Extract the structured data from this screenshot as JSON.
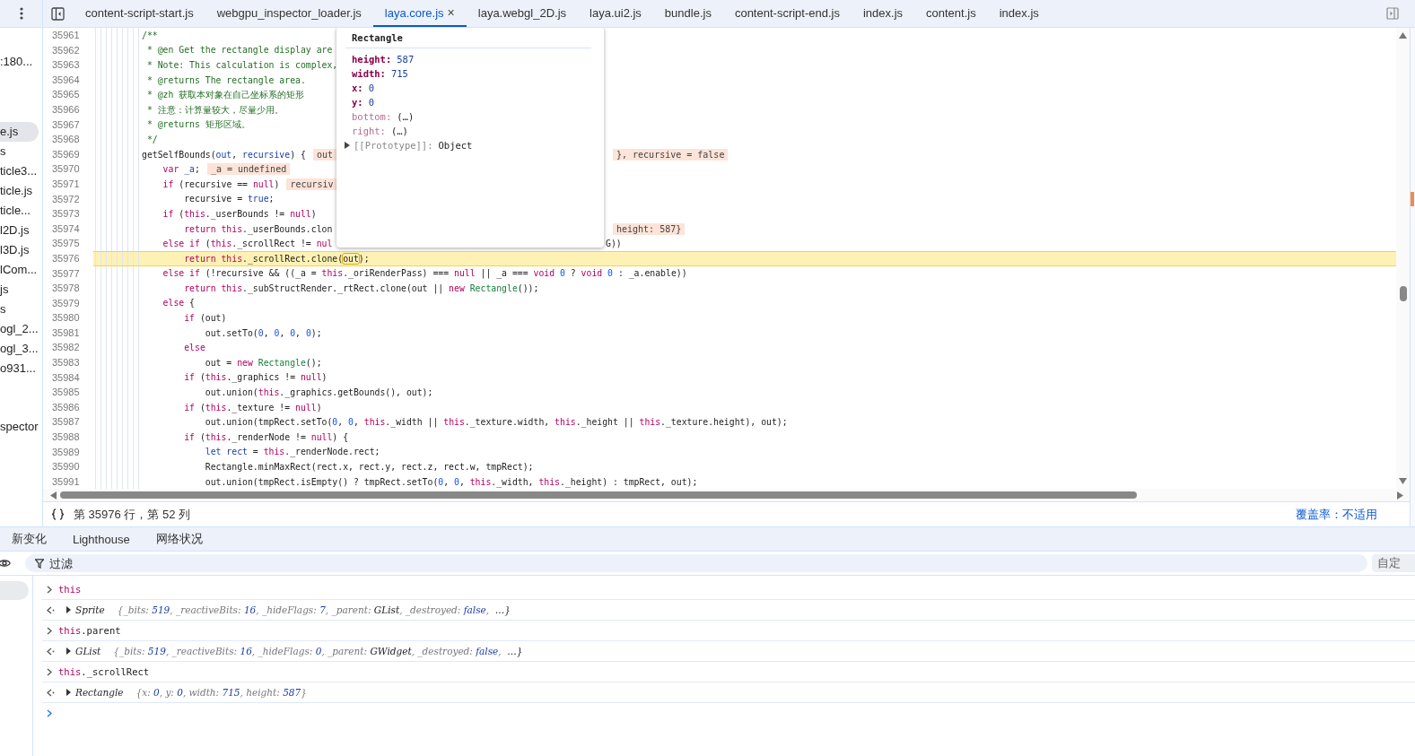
{
  "tabs": [
    {
      "label": "content-script-start.js",
      "selected": false
    },
    {
      "label": "webgpu_inspector_loader.js",
      "selected": false
    },
    {
      "label": "laya.core.js",
      "selected": true,
      "close": "×"
    },
    {
      "label": "laya.webgl_2D.js",
      "selected": false
    },
    {
      "label": "laya.ui2.js",
      "selected": false
    },
    {
      "label": "bundle.js",
      "selected": false
    },
    {
      "label": "content-script-end.js",
      "selected": false
    },
    {
      "label": "index.js",
      "selected": false
    },
    {
      "label": "content.js",
      "selected": false
    },
    {
      "label": "index.js",
      "selected": false
    }
  ],
  "navigator": {
    "groups": [
      [
        {
          "label": ":180...",
          "selected": false
        }
      ],
      [
        {
          "label": "e.js",
          "selected": true
        },
        {
          "label": "s",
          "selected": false
        },
        {
          "label": "ticle3...",
          "selected": false
        },
        {
          "label": "ticle.js",
          "selected": false
        },
        {
          "label": "ticle...",
          "selected": false
        },
        {
          "label": "l2D.js",
          "selected": false
        },
        {
          "label": "l3D.js",
          "selected": false
        },
        {
          "label": "lCom...",
          "selected": false
        },
        {
          "label": "js",
          "selected": false
        },
        {
          "label": "s",
          "selected": false
        },
        {
          "label": "ogl_2...",
          "selected": false
        },
        {
          "label": "ogl_3...",
          "selected": false
        },
        {
          "label": "o931...",
          "selected": false
        }
      ],
      [
        {
          "label": "spector",
          "selected": false
        }
      ]
    ]
  },
  "editor": {
    "lines": [
      {
        "number": "35961",
        "current": false,
        "code": [
          {
            "kind": "comment",
            "text": "/**"
          }
        ]
      },
      {
        "number": "35962",
        "current": false,
        "code": [
          {
            "kind": "comment",
            "text": " * @en Get the rectangle display are"
          }
        ]
      },
      {
        "number": "35963",
        "current": false,
        "code": [
          {
            "kind": "comment",
            "text": " * Note: This calculation is complex,"
          }
        ]
      },
      {
        "number": "35964",
        "current": false,
        "code": [
          {
            "kind": "comment",
            "text": " * @returns The rectangle area."
          }
        ]
      },
      {
        "number": "35965",
        "current": false,
        "code": [
          {
            "kind": "comment",
            "text": " * @zh 获取本对象在自己坐标系的矩形"
          }
        ]
      },
      {
        "number": "35966",
        "current": false,
        "code": [
          {
            "kind": "comment",
            "text": " * 注意：计算量较大，尽量少用。"
          }
        ]
      },
      {
        "number": "35967",
        "current": false,
        "code": [
          {
            "kind": "comment",
            "text": " * @returns 矩形区域。"
          }
        ]
      },
      {
        "number": "35968",
        "current": false,
        "code": [
          {
            "kind": "comment",
            "text": " */"
          }
        ]
      },
      {
        "number": "35969",
        "current": false,
        "code": [
          {
            "kind": "plain",
            "text": "getSelfBounds("
          },
          {
            "kind": "name",
            "text": "out"
          },
          {
            "kind": "plain",
            "text": ", "
          },
          {
            "kind": "name",
            "text": "recursive"
          },
          {
            "kind": "plain",
            "text": ") {"
          }
        ],
        "values": [
          "out"
        ],
        "right_values": [
          "}, recursive = false"
        ]
      },
      {
        "number": "35970",
        "current": false,
        "code": [
          {
            "kind": "keyword",
            "text": "    var "
          },
          {
            "kind": "name",
            "text": "_a"
          },
          {
            "kind": "plain",
            "text": ";"
          }
        ],
        "values": [
          "_a = undefined"
        ]
      },
      {
        "number": "35971",
        "current": false,
        "code": [
          {
            "kind": "keyword",
            "text": "    if "
          },
          {
            "kind": "plain",
            "text": "(recursive == "
          },
          {
            "kind": "keyword",
            "text": "null"
          },
          {
            "kind": "plain",
            "text": ")"
          }
        ],
        "values": [
          "recursiv"
        ]
      },
      {
        "number": "35972",
        "current": false,
        "code": [
          {
            "kind": "plain",
            "text": "        recursive = "
          },
          {
            "kind": "name",
            "text": "true"
          },
          {
            "kind": "plain",
            "text": ";"
          }
        ]
      },
      {
        "number": "35973",
        "current": false,
        "code": [
          {
            "kind": "keyword",
            "text": "    if "
          },
          {
            "kind": "plain",
            "text": "("
          },
          {
            "kind": "keyword",
            "text": "this"
          },
          {
            "kind": "plain",
            "text": "._userBounds != "
          },
          {
            "kind": "keyword",
            "text": "null"
          },
          {
            "kind": "plain",
            "text": ")"
          }
        ]
      },
      {
        "number": "35974",
        "current": false,
        "code": [
          {
            "kind": "keyword",
            "text": "        return this"
          },
          {
            "kind": "plain",
            "text": "._userBounds.clon"
          }
        ],
        "right_values": [
          "height: 587}"
        ]
      },
      {
        "number": "35975",
        "current": false,
        "code": [
          {
            "kind": "keyword",
            "text": "    else if "
          },
          {
            "kind": "plain",
            "text": "("
          },
          {
            "kind": "keyword",
            "text": "this"
          },
          {
            "kind": "plain",
            "text": "._scrollRect != "
          },
          {
            "kind": "keyword",
            "text": "nul"
          }
        ],
        "right_code": [
          {
            "kind": "plain",
            "text": "G))"
          }
        ]
      },
      {
        "number": "35976",
        "current": true,
        "code": [
          {
            "kind": "keyword",
            "text": "        return this"
          },
          {
            "kind": "plain",
            "text": "._scrollRect.clone("
          },
          {
            "kind": "paused",
            "text": "out"
          },
          {
            "kind": "plain",
            "text": ");"
          }
        ]
      },
      {
        "number": "35977",
        "current": false,
        "code": [
          {
            "kind": "keyword",
            "text": "    else if "
          },
          {
            "kind": "plain",
            "text": "(!recursive && ((_a = "
          },
          {
            "kind": "keyword",
            "text": "this"
          },
          {
            "kind": "plain",
            "text": "._oriRenderPass) === "
          },
          {
            "kind": "keyword",
            "text": "null"
          },
          {
            "kind": "plain",
            "text": " || _a === "
          },
          {
            "kind": "keyword",
            "text": "void "
          },
          {
            "kind": "literal",
            "text": "0"
          },
          {
            "kind": "plain",
            "text": " ? "
          },
          {
            "kind": "keyword",
            "text": "void "
          },
          {
            "kind": "literal",
            "text": "0"
          },
          {
            "kind": "plain",
            "text": " : _a.enable))"
          }
        ]
      },
      {
        "number": "35978",
        "current": false,
        "code": [
          {
            "kind": "keyword",
            "text": "        return this"
          },
          {
            "kind": "plain",
            "text": "._subStructRender._rtRect.clone(out || "
          },
          {
            "kind": "keyword",
            "text": "new "
          },
          {
            "kind": "class",
            "text": "Rectangle"
          },
          {
            "kind": "plain",
            "text": "());"
          }
        ]
      },
      {
        "number": "35979",
        "current": false,
        "code": [
          {
            "kind": "keyword",
            "text": "    else "
          },
          {
            "kind": "plain",
            "text": "{"
          }
        ]
      },
      {
        "number": "35980",
        "current": false,
        "code": [
          {
            "kind": "keyword",
            "text": "        if "
          },
          {
            "kind": "plain",
            "text": "(out)"
          }
        ]
      },
      {
        "number": "35981",
        "current": false,
        "code": [
          {
            "kind": "plain",
            "text": "            out.setTo("
          },
          {
            "kind": "literal",
            "text": "0"
          },
          {
            "kind": "plain",
            "text": ", "
          },
          {
            "kind": "literal",
            "text": "0"
          },
          {
            "kind": "plain",
            "text": ", "
          },
          {
            "kind": "literal",
            "text": "0"
          },
          {
            "kind": "plain",
            "text": ", "
          },
          {
            "kind": "literal",
            "text": "0"
          },
          {
            "kind": "plain",
            "text": ");"
          }
        ]
      },
      {
        "number": "35982",
        "current": false,
        "code": [
          {
            "kind": "keyword",
            "text": "        else"
          }
        ]
      },
      {
        "number": "35983",
        "current": false,
        "code": [
          {
            "kind": "plain",
            "text": "            out = "
          },
          {
            "kind": "keyword",
            "text": "new "
          },
          {
            "kind": "class",
            "text": "Rectangle"
          },
          {
            "kind": "plain",
            "text": "();"
          }
        ]
      },
      {
        "number": "35984",
        "current": false,
        "code": [
          {
            "kind": "keyword",
            "text": "        if "
          },
          {
            "kind": "plain",
            "text": "("
          },
          {
            "kind": "keyword",
            "text": "this"
          },
          {
            "kind": "plain",
            "text": "._graphics != "
          },
          {
            "kind": "keyword",
            "text": "null"
          },
          {
            "kind": "plain",
            "text": ")"
          }
        ]
      },
      {
        "number": "35985",
        "current": false,
        "code": [
          {
            "kind": "plain",
            "text": "            out.union("
          },
          {
            "kind": "keyword",
            "text": "this"
          },
          {
            "kind": "plain",
            "text": "._graphics.getBounds(), out);"
          }
        ]
      },
      {
        "number": "35986",
        "current": false,
        "code": [
          {
            "kind": "keyword",
            "text": "        if "
          },
          {
            "kind": "plain",
            "text": "("
          },
          {
            "kind": "keyword",
            "text": "this"
          },
          {
            "kind": "plain",
            "text": "._texture != "
          },
          {
            "kind": "keyword",
            "text": "null"
          },
          {
            "kind": "plain",
            "text": ")"
          }
        ]
      },
      {
        "number": "35987",
        "current": false,
        "code": [
          {
            "kind": "plain",
            "text": "            out.union(tmpRect.setTo("
          },
          {
            "kind": "literal",
            "text": "0"
          },
          {
            "kind": "plain",
            "text": ", "
          },
          {
            "kind": "literal",
            "text": "0"
          },
          {
            "kind": "plain",
            "text": ", "
          },
          {
            "kind": "keyword",
            "text": "this"
          },
          {
            "kind": "plain",
            "text": "._width || "
          },
          {
            "kind": "keyword",
            "text": "this"
          },
          {
            "kind": "plain",
            "text": "._texture.width, "
          },
          {
            "kind": "keyword",
            "text": "this"
          },
          {
            "kind": "plain",
            "text": "._height || "
          },
          {
            "kind": "keyword",
            "text": "this"
          },
          {
            "kind": "plain",
            "text": "._texture.height), out);"
          }
        ]
      },
      {
        "number": "35988",
        "current": false,
        "code": [
          {
            "kind": "keyword",
            "text": "        if "
          },
          {
            "kind": "plain",
            "text": "("
          },
          {
            "kind": "keyword",
            "text": "this"
          },
          {
            "kind": "plain",
            "text": "._renderNode != "
          },
          {
            "kind": "keyword",
            "text": "null"
          },
          {
            "kind": "plain",
            "text": ") {"
          }
        ]
      },
      {
        "number": "35989",
        "current": false,
        "code": [
          {
            "kind": "name",
            "text": "            let rect"
          },
          {
            "kind": "plain",
            "text": " = "
          },
          {
            "kind": "keyword",
            "text": "this"
          },
          {
            "kind": "plain",
            "text": "._renderNode.rect;"
          }
        ]
      },
      {
        "number": "35990",
        "current": false,
        "code": [
          {
            "kind": "plain",
            "text": "            Rectangle.minMaxRect(rect.x, rect.y, rect.z, rect.w, tmpRect);"
          }
        ]
      },
      {
        "number": "35991",
        "current": false,
        "code": [
          {
            "kind": "plain",
            "text": "            out.union(tmpRect.isEmpty() ? tmpRect.setTo("
          },
          {
            "kind": "literal",
            "text": "0"
          },
          {
            "kind": "plain",
            "text": ", "
          },
          {
            "kind": "literal",
            "text": "0"
          },
          {
            "kind": "plain",
            "text": ", "
          },
          {
            "kind": "keyword",
            "text": "this"
          },
          {
            "kind": "plain",
            "text": "._width, "
          },
          {
            "kind": "keyword",
            "text": "this"
          },
          {
            "kind": "plain",
            "text": "._height) : tmpRect, out);"
          }
        ]
      }
    ],
    "popover": {
      "title": "Rectangle",
      "props": [
        {
          "name": "height:",
          "value": "587",
          "kind": "own"
        },
        {
          "name": "width:",
          "value": "715",
          "kind": "own"
        },
        {
          "name": "x:",
          "value": "0",
          "kind": "own"
        },
        {
          "name": "y:",
          "value": "0",
          "kind": "own"
        },
        {
          "name": "bottom:",
          "value": "(…)",
          "kind": "accessor"
        },
        {
          "name": "right:",
          "value": "(…)",
          "kind": "accessor"
        }
      ],
      "prototype": "[[Prototype]]:",
      "prototype_value": "Object"
    },
    "status": {
      "position": "第 35976 行，第 52 列",
      "coverage": "覆盖率：不适用"
    }
  },
  "drawer": {
    "tabs": [
      "新变化",
      "Lighthouse",
      "网络状况"
    ],
    "filter": {
      "placeholder": "过滤"
    },
    "levels": "自定",
    "entries": [
      {
        "kind": "input",
        "segments": [
          {
            "kind": "keyword",
            "text": "this"
          }
        ]
      },
      {
        "kind": "output",
        "type": "Sprite",
        "segments": [
          {
            "kind": "key",
            "text": "{_bits: "
          },
          {
            "kind": "num",
            "text": "519"
          },
          {
            "kind": "key",
            "text": ", _reactiveBits: "
          },
          {
            "kind": "num",
            "text": "16"
          },
          {
            "kind": "key",
            "text": ", _hideFlags: "
          },
          {
            "kind": "num",
            "text": "7"
          },
          {
            "kind": "key",
            "text": ", _parent: "
          },
          {
            "kind": "obj",
            "text": "GList"
          },
          {
            "kind": "key",
            "text": ", _destroyed: "
          },
          {
            "kind": "num",
            "text": "false"
          },
          {
            "kind": "key",
            "text": ",  "
          },
          {
            "kind": "obj",
            "text": "…}"
          }
        ]
      },
      {
        "kind": "input",
        "segments": [
          {
            "kind": "keyword",
            "text": "this"
          },
          {
            "kind": "plain",
            "text": ".parent"
          }
        ]
      },
      {
        "kind": "output",
        "type": "GList",
        "segments": [
          {
            "kind": "key",
            "text": "{_bits: "
          },
          {
            "kind": "num",
            "text": "519"
          },
          {
            "kind": "key",
            "text": ", _reactiveBits: "
          },
          {
            "kind": "num",
            "text": "16"
          },
          {
            "kind": "key",
            "text": ", _hideFlags: "
          },
          {
            "kind": "num",
            "text": "0"
          },
          {
            "kind": "key",
            "text": ", _parent: "
          },
          {
            "kind": "obj",
            "text": "GWidget"
          },
          {
            "kind": "key",
            "text": ", _destroyed: "
          },
          {
            "kind": "num",
            "text": "false"
          },
          {
            "kind": "key",
            "text": ",  "
          },
          {
            "kind": "obj",
            "text": "…}"
          }
        ]
      },
      {
        "kind": "input",
        "segments": [
          {
            "kind": "keyword",
            "text": "this"
          },
          {
            "kind": "plain",
            "text": "._scrollRect"
          }
        ]
      },
      {
        "kind": "output",
        "type": "Rectangle",
        "segments": [
          {
            "kind": "key",
            "text": "{x: "
          },
          {
            "kind": "num",
            "text": "0"
          },
          {
            "kind": "key",
            "text": ", y: "
          },
          {
            "kind": "num",
            "text": "0"
          },
          {
            "kind": "key",
            "text": ", width: "
          },
          {
            "kind": "num",
            "text": "715"
          },
          {
            "kind": "key",
            "text": ", height: "
          },
          {
            "kind": "num",
            "text": "587"
          },
          {
            "kind": "key",
            "text": "}"
          }
        ]
      }
    ]
  }
}
